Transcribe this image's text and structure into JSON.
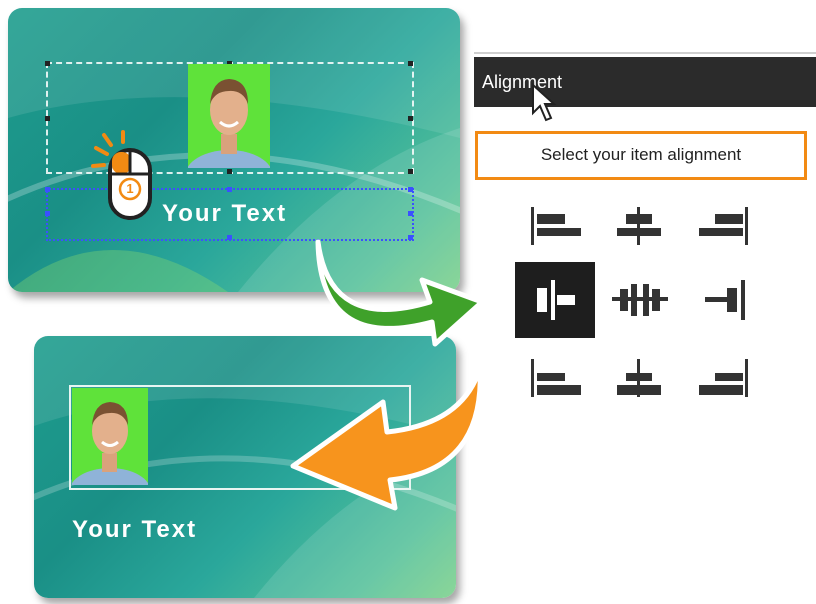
{
  "card_top": {
    "text": "Your Text"
  },
  "card_bottom": {
    "text": "Your Text"
  },
  "mouse_step": {
    "number": "1"
  },
  "panel": {
    "header": "Alignment",
    "instruction": "Select your item alignment",
    "alignment_options": [
      {
        "name": "top-left",
        "selected": false
      },
      {
        "name": "top-center",
        "selected": false
      },
      {
        "name": "top-right",
        "selected": false
      },
      {
        "name": "middle-left",
        "selected": true
      },
      {
        "name": "middle-center",
        "selected": false
      },
      {
        "name": "middle-right",
        "selected": false
      },
      {
        "name": "bottom-left",
        "selected": false
      },
      {
        "name": "bottom-center",
        "selected": false
      },
      {
        "name": "bottom-right",
        "selected": false
      }
    ]
  },
  "colors": {
    "card_teal": "#1e9d8e",
    "photo_background": "#5fe23a",
    "highlight_orange": "#f28a13",
    "arrow_green": "#3fa12a",
    "arrow_orange": "#f7941d",
    "panel_header": "#2b2b2b"
  }
}
